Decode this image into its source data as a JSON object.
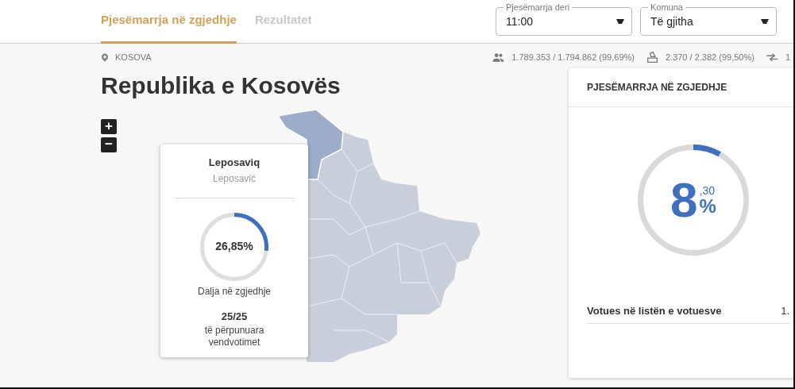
{
  "tabs": [
    {
      "label": "Pjesëmarrja në zgjedhje",
      "selected": true
    },
    {
      "label": "Rezultatet",
      "selected": false
    }
  ],
  "filters": [
    {
      "label": "Pjesëmarrja deri",
      "value": "11:00"
    },
    {
      "label": "Komuna",
      "value": "Të gjitha"
    }
  ],
  "location": "KOSOVA",
  "stats": [
    {
      "kind": "voters",
      "text": "1.789.353 / 1.794.862 (99,69%)"
    },
    {
      "kind": "stations",
      "text": "2.370 / 2.382 (99,50%)"
    },
    {
      "kind": "transfer",
      "text": "1"
    }
  ],
  "title": "Republika e Kosovës",
  "zoom_controls": [
    "+",
    "−"
  ],
  "tooltip": {
    "name": "Leposaviq",
    "alt_name": "Leposavić",
    "percent": "26,85%",
    "caption": "Dalja në zgjedhje",
    "count": "25/25",
    "count_caption": "të përpunuara vendvotimet"
  },
  "turnout_card": {
    "title": "PJESËMARRJA NË ZGJEDHJE",
    "whole": "8",
    "decimal": ",30",
    "unit": "%",
    "rows": [
      {
        "label": "Votues në listën e votuesve",
        "value": "1."
      }
    ]
  }
}
